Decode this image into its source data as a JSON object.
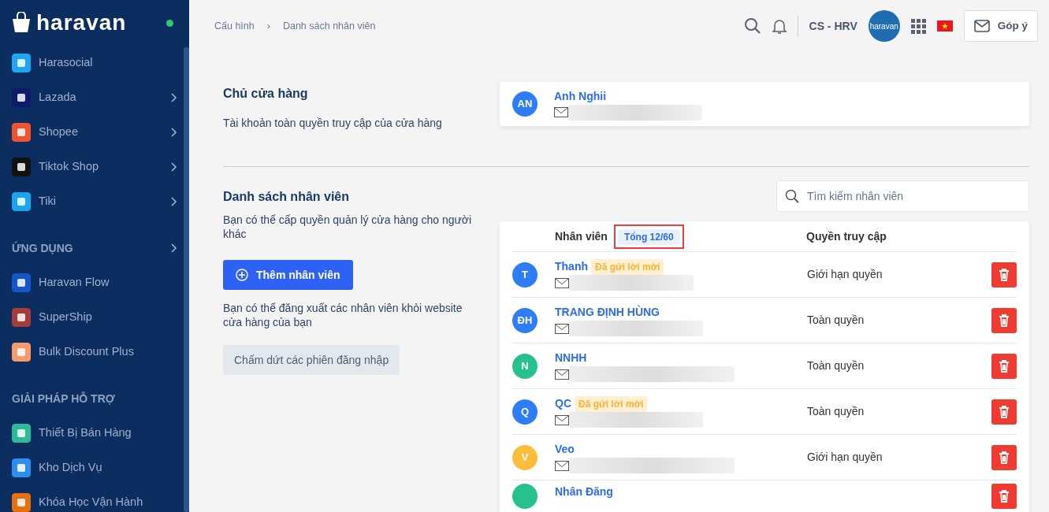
{
  "sidebar": {
    "logo": "haravan",
    "online": true,
    "groups": [
      {
        "items": [
          {
            "label": "Harasocial",
            "color": "#1ea7f0",
            "submenu": false
          },
          {
            "label": "Lazada",
            "color": "#101a6b",
            "submenu": true
          },
          {
            "label": "Shopee",
            "color": "#f0542d",
            "submenu": true
          },
          {
            "label": "Tiktok Shop",
            "color": "#111111",
            "submenu": true
          },
          {
            "label": "Tiki",
            "color": "#1aa5f0",
            "submenu": true
          }
        ]
      },
      {
        "title": "ỨNG DỤNG",
        "submenu": true,
        "items": [
          {
            "label": "Haravan Flow",
            "color": "#1655c8",
            "submenu": false
          },
          {
            "label": "SuperShip",
            "color": "#a83a3a",
            "submenu": false
          },
          {
            "label": "Bulk Discount Plus",
            "color": "#f59a6a",
            "submenu": false
          }
        ]
      },
      {
        "title": "GIẢI PHÁP HỖ TRỢ",
        "items": [
          {
            "label": "Thiết Bị Bán Hàng",
            "color": "#2dbb9a",
            "submenu": false
          },
          {
            "label": "Kho Dịch Vụ",
            "color": "#2e8ef0",
            "submenu": false
          },
          {
            "label": "Khóa Học Vận Hành",
            "color": "#e6700f",
            "submenu": false
          }
        ]
      }
    ]
  },
  "breadcrumb": [
    "Cấu hình",
    "›",
    "Danh sách nhân viên"
  ],
  "header": {
    "store": "CS - HRV",
    "avatar": "haravan",
    "feedback": "Góp ý"
  },
  "owner_section": {
    "title": "Chủ cửa hàng",
    "description": "Tài khoản toàn quyền truy cập của cửa hàng",
    "owner": {
      "initials": "AN",
      "name": "Anh Nghii",
      "color": "#2e7cf6"
    }
  },
  "staff_section": {
    "title": "Danh sách nhân viên",
    "description": "Bạn có thể cấp quyền quản lý cửa hàng cho người khác",
    "add_button": "Thêm nhân viên",
    "logout_description": "Bạn có thể đăng xuất các nhân viên khỏi website cửa hàng của bạn",
    "logout_button": "Chấm dứt các phiên đăng nhập",
    "search": {
      "placeholder": "Tìm kiếm nhân viên"
    },
    "table": {
      "columns": [
        "Nhân viên",
        "Quyền truy cập"
      ],
      "total": "Tổng 12/60",
      "rows": [
        {
          "initials": "T",
          "name": "Thanh",
          "color": "#2e7cf6",
          "invite": "Đã gửi lời mời",
          "access": "Giới hạn quyền"
        },
        {
          "initials": "ĐH",
          "name": "TRANG ĐỊNH HÙNG",
          "color": "#2e7cf6",
          "access": "Toàn quyền"
        },
        {
          "initials": "N",
          "name": "NNHH",
          "color": "#27c28c",
          "access": "Toàn quyền"
        },
        {
          "initials": "Q",
          "name": "QC",
          "color": "#2e7cf6",
          "invite": "Đã gửi lời mời",
          "access": "Toàn quyền"
        },
        {
          "initials": "V",
          "name": "Veo",
          "color": "#fbbd3c",
          "access": "Giới hạn quyền"
        },
        {
          "name": "Nhân Đăng",
          "color": "#27c28c"
        }
      ]
    }
  }
}
